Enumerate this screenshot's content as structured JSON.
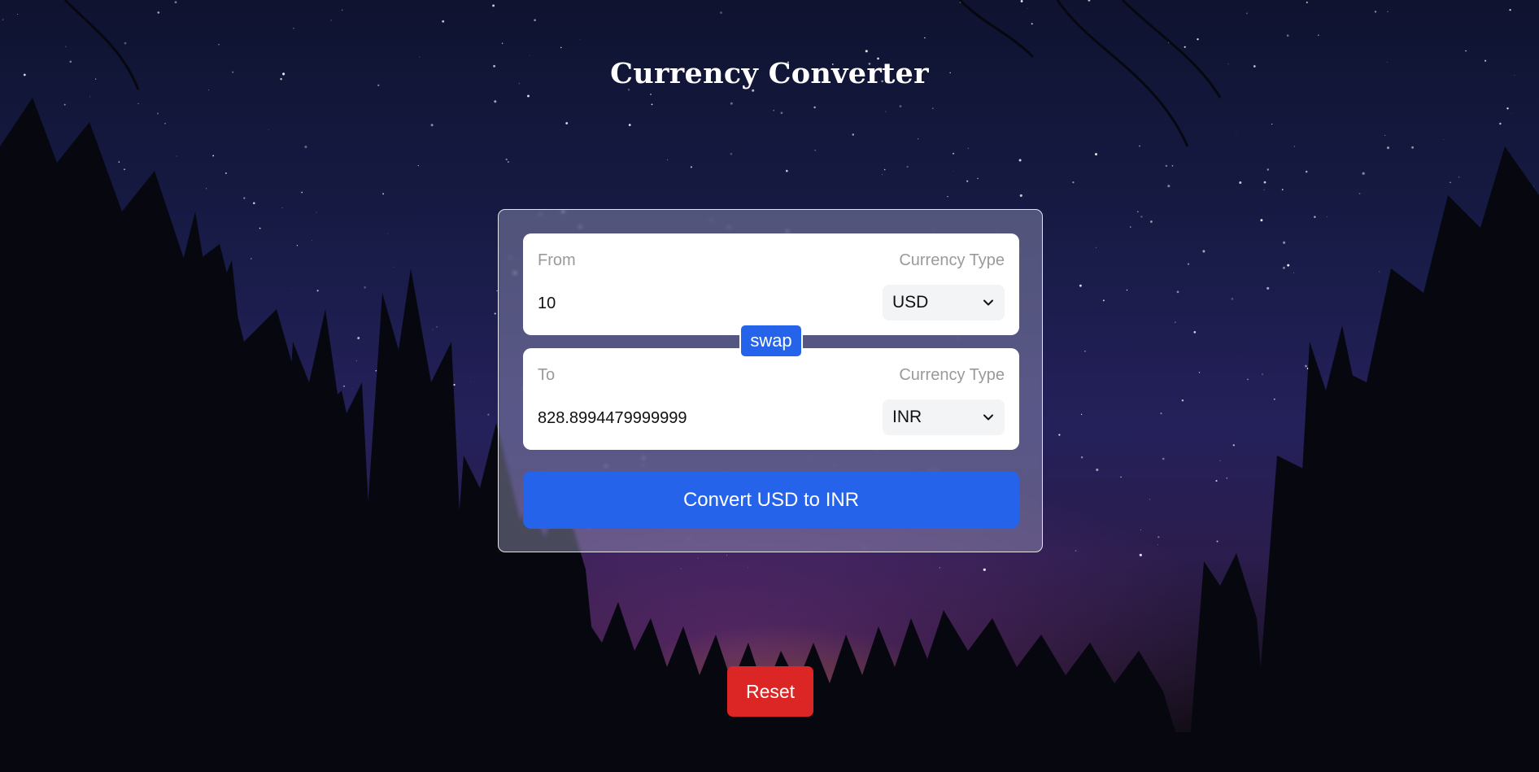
{
  "app": {
    "title": "Currency Converter"
  },
  "from": {
    "label": "From",
    "type_label": "Currency Type",
    "amount": "10",
    "currency": "USD"
  },
  "to": {
    "label": "To",
    "type_label": "Currency Type",
    "amount": "828.8994479999999",
    "currency": "INR"
  },
  "actions": {
    "swap_label": "swap",
    "convert_label": "Convert USD to INR",
    "reset_label": "Reset"
  },
  "colors": {
    "primary": "#2563eb",
    "danger": "#dc2626",
    "card_border": "#ffffff",
    "muted_text": "#9a9a9a"
  },
  "icons": {
    "select_arrow": "chevron-down-icon"
  }
}
